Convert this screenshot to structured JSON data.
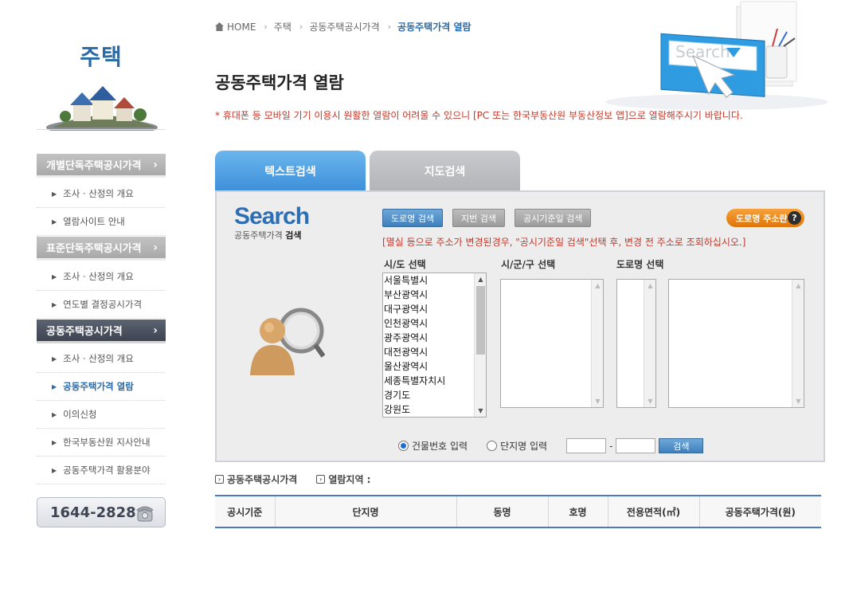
{
  "sidebar": {
    "title": "주택",
    "menu1": {
      "label": "개별단독주택공시가격",
      "items": [
        "조사 · 산정의 개요",
        "열람사이트 안내"
      ]
    },
    "menu2": {
      "label": "표준단독주택공시가격",
      "items": [
        "조사 · 산정의 개요",
        "연도별 결정공시가격"
      ]
    },
    "menu3": {
      "label": "공동주택공시가격",
      "items": [
        "조사 · 산정의 개요",
        "공동주택가격 열람",
        "이의신청",
        "한국부동산원 지사안내",
        "공동주택가격 활용분야"
      ]
    },
    "phone": "1644-2828"
  },
  "breadcrumb": {
    "home": "HOME",
    "b1": "주택",
    "b2": "공동주택공시가격",
    "b3": "공동주택가격 열람"
  },
  "page": {
    "title": "공동주택가격 열람",
    "notice": "* 휴대폰 등 모바일 기기 이용시 원활한 열람이 어려울 수 있으니 [PC 또는 한국부동산원 부동산정보 앱]으로 열람해주시기 바랍니다."
  },
  "header_art": {
    "search_word": "Search"
  },
  "tabs": {
    "text": "텍스트검색",
    "map": "지도검색"
  },
  "search": {
    "logo_big": "Search",
    "logo_small_a": "공동주택가격",
    "logo_small_b": "검색",
    "btn_road": "도로명 검색",
    "btn_lot": "지번 검색",
    "btn_date": "공시기준일 검색",
    "btn_road_addr": "도로명 주소란",
    "hint": "[멸실 등으로 주소가 변경된경우, \"공시기준일 검색\"선택 후, 변경 전 주소로 조회하십시오.]",
    "label_sido": "시/도 선택",
    "label_sigungu": "시/군/구 선택",
    "label_road": "도로명 선택",
    "sido_options": [
      "서울특별시",
      "부산광역시",
      "대구광역시",
      "인천광역시",
      "광주광역시",
      "대전광역시",
      "울산광역시",
      "세종특별자치시",
      "경기도",
      "강원도"
    ],
    "radio_building": "건물번호 입력",
    "radio_complex": "단지명 입력",
    "dash": "-",
    "go": "검색"
  },
  "results": {
    "head1": "공동주택공시가격",
    "head2": "열람지역 :",
    "columns": [
      "공시기준",
      "단지명",
      "동명",
      "호명",
      "전용면적(㎡)",
      "공동주택가격(원)"
    ]
  }
}
